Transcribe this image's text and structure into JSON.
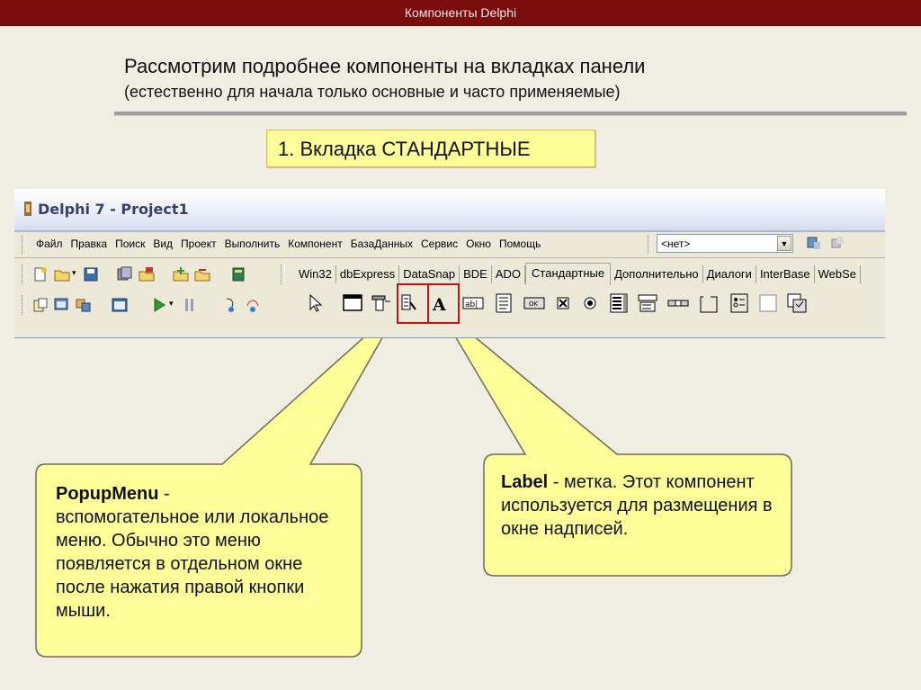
{
  "slide": {
    "top_title": "Компоненты Delphi",
    "heading_main": "Рассмотрим подробнее компоненты на вкладках панели",
    "heading_sub": "(естественно для начала только основные и часто применяемые)",
    "tab_note": "1. Вкладка СТАНДАРТНЫЕ"
  },
  "ide": {
    "window_title": "Delphi 7 - Project1",
    "menu": [
      "Файл",
      "Правка",
      "Поиск",
      "Вид",
      "Проект",
      "Выполнить",
      "Компонент",
      "БазаДанных",
      "Сервис",
      "Окно",
      "Помощь"
    ],
    "combo_value": "<нет>",
    "tabs": [
      {
        "label": "Win32",
        "active": false
      },
      {
        "label": "dbExpress",
        "active": false
      },
      {
        "label": "DataSnap",
        "active": false
      },
      {
        "label": "BDE",
        "active": false
      },
      {
        "label": "ADO",
        "active": false
      },
      {
        "label": "Стандартные",
        "active": true
      },
      {
        "label": "Дополнительно",
        "active": false
      },
      {
        "label": "Диалоги",
        "active": false
      },
      {
        "label": "InterBase",
        "active": false
      },
      {
        "label": "WebSe",
        "active": false
      }
    ]
  },
  "callouts": {
    "popup": {
      "term": "PopupMenu",
      "dash": " -",
      "text": "вспомогательное или локальное меню. Обычно это меню появляется в отдельном окне после нажатия правой кнопки мыши."
    },
    "label": {
      "term": "Label",
      "text": " - метка. Этот компонент используется для размещения в окне надписей."
    }
  },
  "colors": {
    "top_bar": "#7a0c0c",
    "callout_fill": "#ffff99",
    "highlight": "#d01010"
  }
}
